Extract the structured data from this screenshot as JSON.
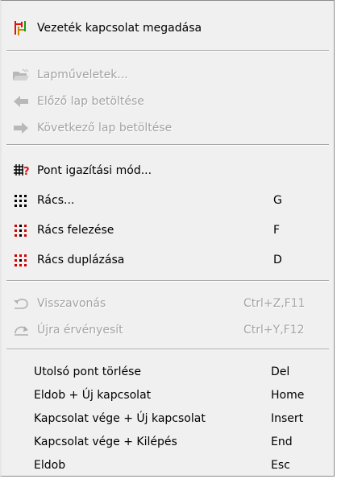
{
  "menu": {
    "items": [
      {
        "label": "Vezeték kapcsolat megadása",
        "shortcut": "",
        "icon": "wire-connection-icon",
        "enabled": true
      },
      {
        "label": "Lapműveletek...",
        "shortcut": "",
        "icon": "open-folder-icon",
        "enabled": false
      },
      {
        "label": "Előző lap betöltése",
        "shortcut": "",
        "icon": "arrow-left-icon",
        "enabled": false
      },
      {
        "label": "Következő lap betöltése",
        "shortcut": "",
        "icon": "arrow-right-icon",
        "enabled": false
      },
      {
        "label": "Pont igazítási mód...",
        "shortcut": "",
        "icon": "snap-point-icon",
        "enabled": true
      },
      {
        "label": "Rács...",
        "shortcut": "G",
        "icon": "grid-icon",
        "enabled": true
      },
      {
        "label": "Rács felezése",
        "shortcut": "F",
        "icon": "grid-halve-icon",
        "enabled": true
      },
      {
        "label": "Rács duplázása",
        "shortcut": "D",
        "icon": "grid-double-icon",
        "enabled": true
      },
      {
        "label": "Visszavonás",
        "shortcut": "Ctrl+Z,F11",
        "icon": "undo-icon",
        "enabled": false
      },
      {
        "label": "Újra érvényesít",
        "shortcut": "Ctrl+Y,F12",
        "icon": "redo-icon",
        "enabled": false
      },
      {
        "label": "Utolsó pont törlése",
        "shortcut": "Del",
        "icon": "",
        "enabled": true
      },
      {
        "label": "Eldob + Új kapcsolat",
        "shortcut": "Home",
        "icon": "",
        "enabled": true
      },
      {
        "label": "Kapcsolat vége + Új kapcsolat",
        "shortcut": "Insert",
        "icon": "",
        "enabled": true
      },
      {
        "label": "Kapcsolat vége + Kilépés",
        "shortcut": "End",
        "icon": "",
        "enabled": true
      },
      {
        "label": "Eldob",
        "shortcut": "Esc",
        "icon": "",
        "enabled": true
      }
    ]
  },
  "colors": {
    "menu_background": "#f0f0f0",
    "disabled_text": "#a3a3a3",
    "grid_dots_black": "#000000",
    "grid_dots_red": "#d00000",
    "wire_red": "#e01010",
    "wire_green": "#10a010"
  }
}
